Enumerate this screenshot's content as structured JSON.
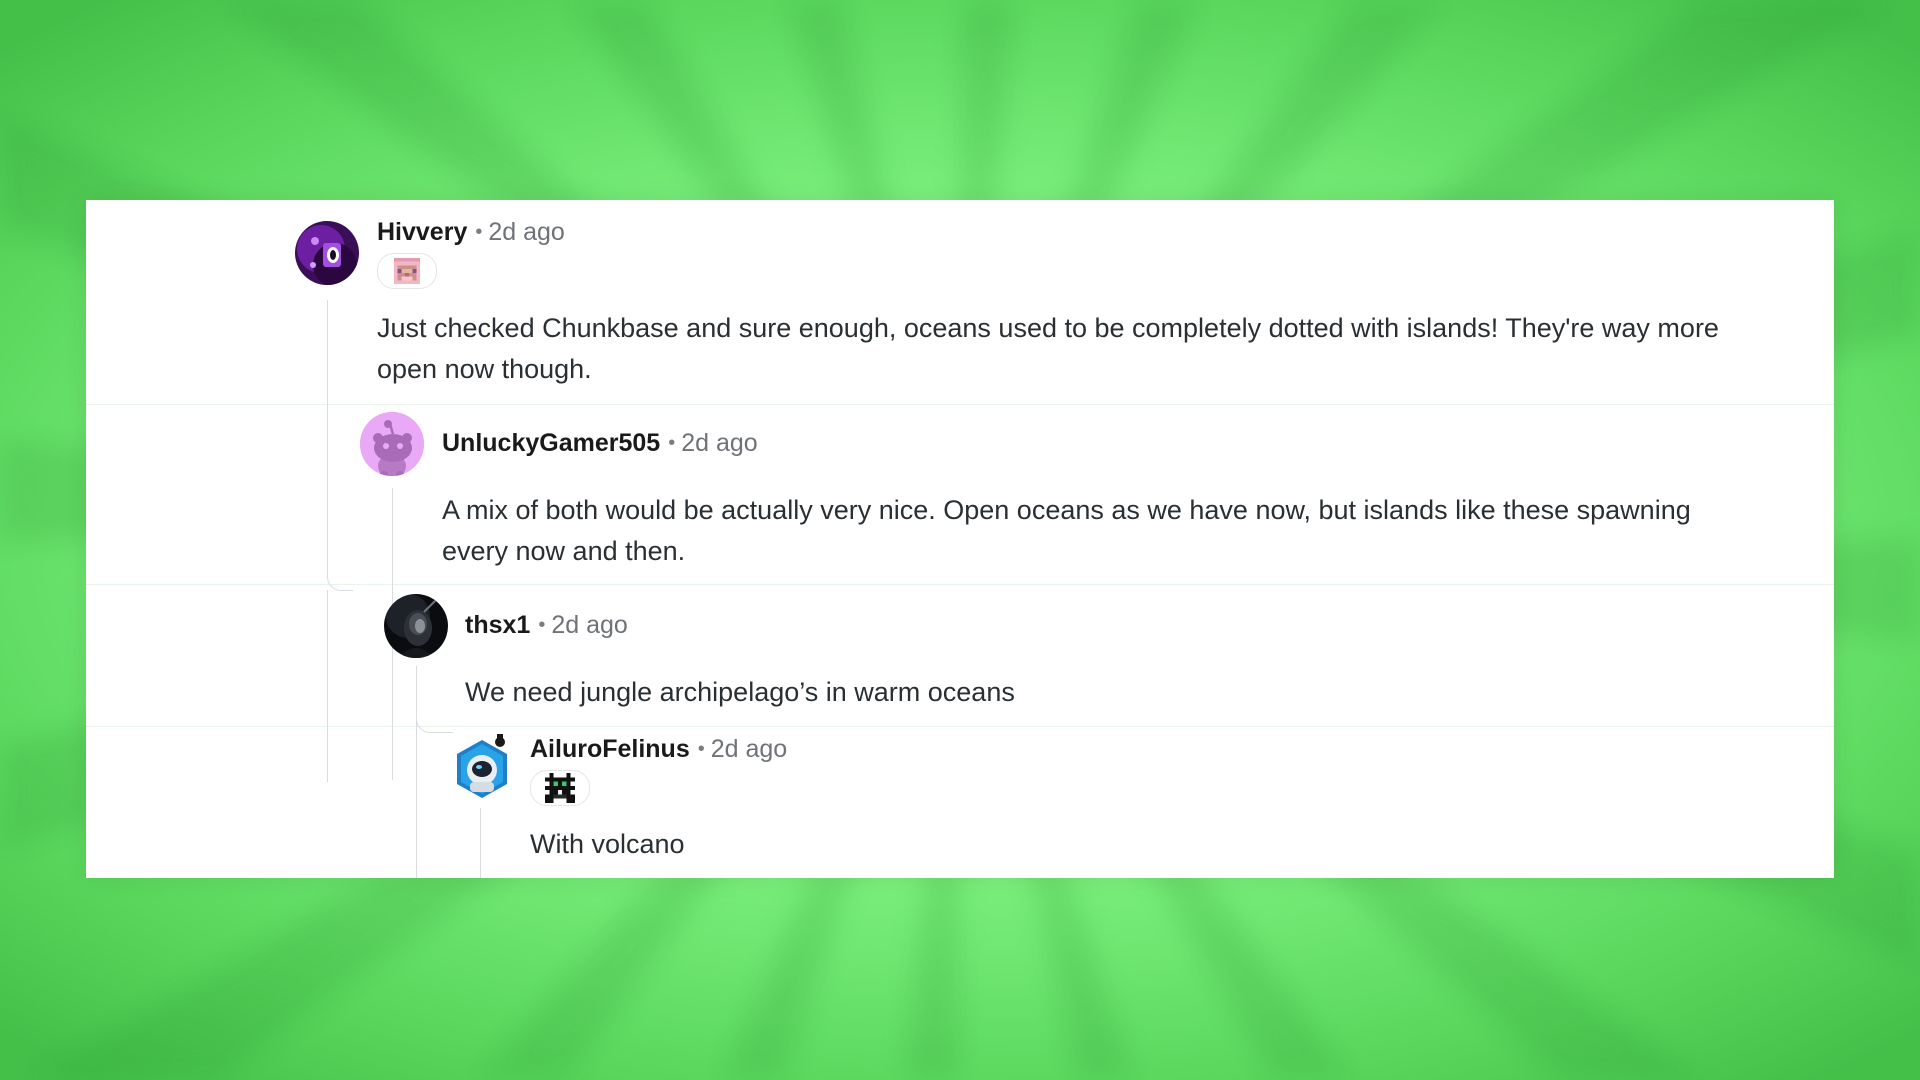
{
  "thread": {
    "comments": [
      {
        "username": "Hivvery",
        "separator": "•",
        "time": "2d ago",
        "avatar": "purple-character-avatar-icon",
        "flair": "pink-pixel-sheep-icon",
        "body": "Just checked Chunkbase and sure enough, oceans used to be completely dotted with islands! They're way more open now though."
      },
      {
        "username": "UnluckyGamer505",
        "separator": "•",
        "time": "2d ago",
        "avatar": "reddit-snoo-default-avatar-icon",
        "body": "A mix of both would be actually very nice. Open oceans as we have now, but islands like these spawning every now and then."
      },
      {
        "username": "thsx1",
        "separator": "•",
        "time": "2d ago",
        "avatar": "dark-figure-avatar-icon",
        "body": "We need jungle archipelago’s in warm oceans"
      },
      {
        "username": "AiluroFelinus",
        "separator": "•",
        "time": "2d ago",
        "avatar": "astronaut-hexagon-avatar-icon",
        "flair": "black-pixel-creature-icon",
        "body": "With volcano"
      }
    ]
  },
  "colors": {
    "background": "#7ef27f",
    "panel": "#ffffff",
    "username": "#1a1a1b",
    "timestamp": "#6f7378",
    "body_text": "#2a2f33",
    "thread_line": "#dadde0"
  }
}
